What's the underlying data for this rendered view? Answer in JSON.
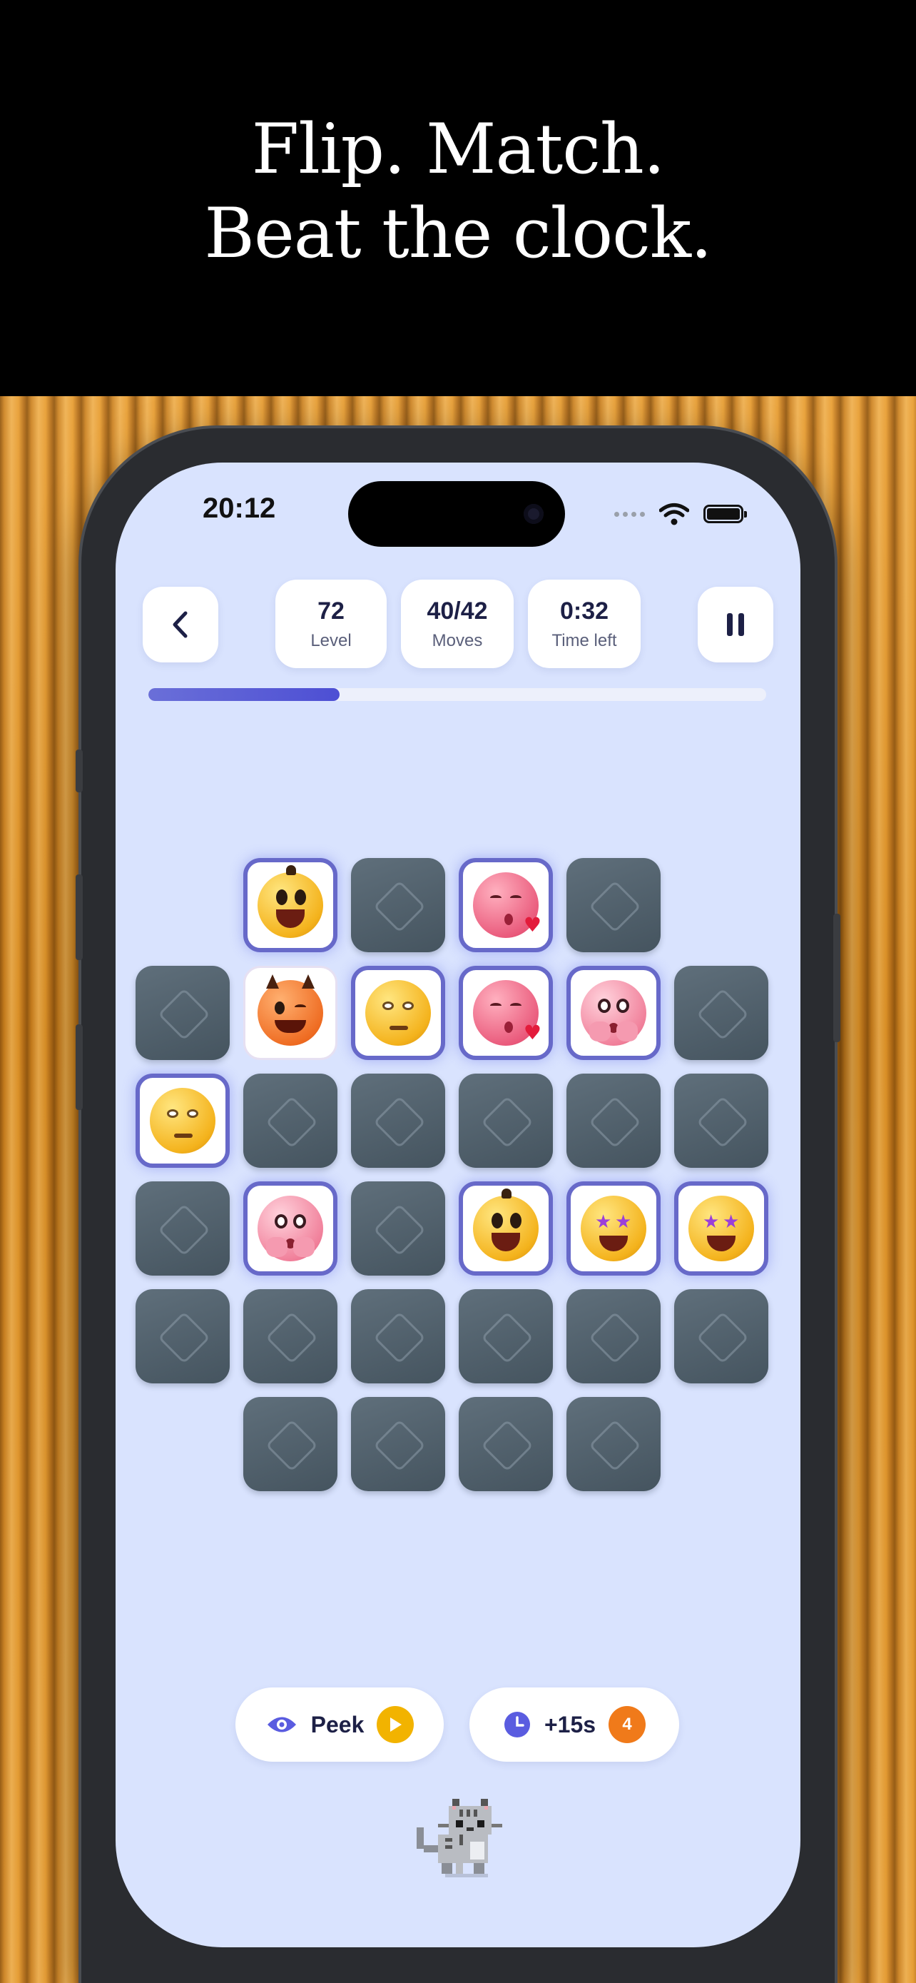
{
  "banner": {
    "line1": "Flip. Match.",
    "line2": "Beat the clock."
  },
  "status_bar": {
    "time": "20:12",
    "icons": [
      "cellular-dots-icon",
      "wifi-icon",
      "battery-icon"
    ]
  },
  "header": {
    "back_icon": "chevron-left-icon",
    "pause_icon": "pause-icon",
    "stats": [
      {
        "value": "72",
        "label": "Level"
      },
      {
        "value": "40/42",
        "label": "Moves"
      },
      {
        "value": "0:32",
        "label": "Time left"
      }
    ],
    "time_progress": 0.31
  },
  "board": {
    "rows": [
      [
        "",
        "grinning-face",
        "hidden",
        "kissing-face-heart",
        "hidden",
        ""
      ],
      [
        "hidden",
        "winking-devil-face",
        "eye-roll-face",
        "kissing-face-heart",
        "pleading-hands-face",
        "hidden"
      ],
      [
        "eye-roll-face",
        "hidden",
        "hidden",
        "hidden",
        "hidden",
        "hidden"
      ],
      [
        "hidden",
        "pleading-hands-face",
        "hidden",
        "grinning-face",
        "star-struck-face",
        "star-struck-face"
      ],
      [
        "hidden",
        "hidden",
        "hidden",
        "hidden",
        "hidden",
        "hidden"
      ],
      [
        "",
        "hidden",
        "hidden",
        "hidden",
        "hidden",
        ""
      ]
    ]
  },
  "powerups": {
    "peek": {
      "label": "Peek",
      "icon": "eye-icon",
      "badge_icon": "play-icon",
      "badge_color": "#f2b300"
    },
    "time": {
      "label": "+15s",
      "icon": "clock-icon",
      "badge": "4",
      "badge_color": "#f07a1a"
    }
  },
  "mascot": "pixel-cat",
  "colors": {
    "accent": "#5a5ce0",
    "screen_bg": "#d9e3fe",
    "tile_hidden": "#52626e"
  }
}
